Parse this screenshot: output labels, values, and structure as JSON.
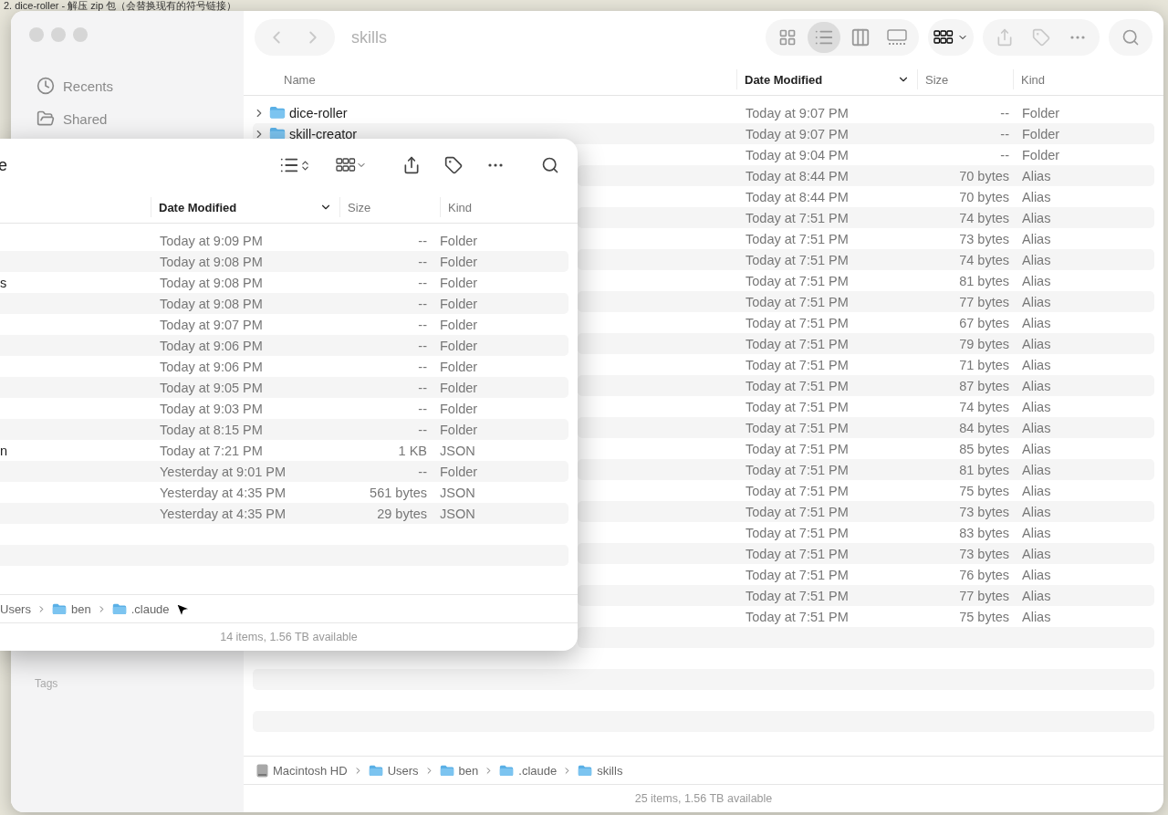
{
  "desktop": {
    "note": "2. dice-roller - 解压 zip 包（会替换现有的符号链接）"
  },
  "back_window": {
    "active": false,
    "title": "skills",
    "sidebar": {
      "items": [
        {
          "label": "Recents"
        },
        {
          "label": "Shared"
        }
      ],
      "tags_heading": "Tags"
    },
    "view_modes": [
      {
        "kind": "icons",
        "selected": false
      },
      {
        "kind": "list",
        "selected": true
      },
      {
        "kind": "columns",
        "selected": false
      },
      {
        "kind": "gallery",
        "selected": false
      }
    ],
    "columns": [
      {
        "label": "Name",
        "sorted": false
      },
      {
        "label": "Date Modified",
        "sorted": true
      },
      {
        "label": "Size",
        "sorted": false
      },
      {
        "label": "Kind",
        "sorted": false
      }
    ],
    "rows": [
      {
        "name": "dice-roller",
        "expanded": false,
        "date": "Today at 9:07 PM",
        "size": "--",
        "file_kind": "Folder"
      },
      {
        "name": "skill-creator",
        "expanded": false,
        "date": "Today at 9:07 PM",
        "size": "--",
        "file_kind": "Folder"
      },
      {
        "date": "Today at 9:04 PM",
        "size": "--",
        "file_kind": "Folder"
      },
      {
        "date": "Today at 8:44 PM",
        "size": "70 bytes",
        "file_kind": "Alias"
      },
      {
        "date": "Today at 8:44 PM",
        "size": "70 bytes",
        "file_kind": "Alias"
      },
      {
        "date": "Today at 7:51 PM",
        "size": "74 bytes",
        "file_kind": "Alias"
      },
      {
        "date": "Today at 7:51 PM",
        "size": "73 bytes",
        "file_kind": "Alias"
      },
      {
        "date": "Today at 7:51 PM",
        "size": "74 bytes",
        "file_kind": "Alias"
      },
      {
        "date": "Today at 7:51 PM",
        "size": "81 bytes",
        "file_kind": "Alias"
      },
      {
        "date": "Today at 7:51 PM",
        "size": "77 bytes",
        "file_kind": "Alias"
      },
      {
        "date": "Today at 7:51 PM",
        "size": "67 bytes",
        "file_kind": "Alias"
      },
      {
        "date": "Today at 7:51 PM",
        "size": "79 bytes",
        "file_kind": "Alias"
      },
      {
        "date": "Today at 7:51 PM",
        "size": "71 bytes",
        "file_kind": "Alias"
      },
      {
        "date": "Today at 7:51 PM",
        "size": "87 bytes",
        "file_kind": "Alias"
      },
      {
        "date": "Today at 7:51 PM",
        "size": "74 bytes",
        "file_kind": "Alias"
      },
      {
        "date": "Today at 7:51 PM",
        "size": "84 bytes",
        "file_kind": "Alias"
      },
      {
        "date": "Today at 7:51 PM",
        "size": "85 bytes",
        "file_kind": "Alias"
      },
      {
        "date": "Today at 7:51 PM",
        "size": "81 bytes",
        "file_kind": "Alias"
      },
      {
        "date": "Today at 7:51 PM",
        "size": "75 bytes",
        "file_kind": "Alias"
      },
      {
        "date": "Today at 7:51 PM",
        "size": "73 bytes",
        "file_kind": "Alias"
      },
      {
        "date": "Today at 7:51 PM",
        "size": "83 bytes",
        "file_kind": "Alias"
      },
      {
        "date": "Today at 7:51 PM",
        "size": "73 bytes",
        "file_kind": "Alias"
      },
      {
        "date": "Today at 7:51 PM",
        "size": "76 bytes",
        "file_kind": "Alias"
      },
      {
        "date": "Today at 7:51 PM",
        "size": "77 bytes",
        "file_kind": "Alias"
      },
      {
        "date": "Today at 7:51 PM",
        "size": "75 bytes",
        "file_kind": "Alias"
      }
    ],
    "path": [
      {
        "label": "Macintosh HD",
        "kind": "disk"
      },
      {
        "label": "Users",
        "kind": "folder"
      },
      {
        "label": "ben",
        "kind": "folder"
      },
      {
        "label": ".claude",
        "kind": "folder"
      },
      {
        "label": "skills",
        "kind": "folder"
      }
    ],
    "status": "25 items, 1.56 TB available"
  },
  "front_window": {
    "title": "e",
    "columns": [
      {
        "label": "Date Modified",
        "sorted": true
      },
      {
        "label": "Size",
        "sorted": false
      },
      {
        "label": "Kind",
        "sorted": false
      }
    ],
    "rows": [
      {
        "date": "Today at 9:09 PM",
        "size": "--",
        "file_kind": "Folder"
      },
      {
        "date": "Today at 9:08 PM",
        "size": "--",
        "file_kind": "Folder"
      },
      {
        "name": "s",
        "date": "Today at 9:08 PM",
        "size": "--",
        "file_kind": "Folder"
      },
      {
        "date": "Today at 9:08 PM",
        "size": "--",
        "file_kind": "Folder"
      },
      {
        "date": "Today at 9:07 PM",
        "size": "--",
        "file_kind": "Folder"
      },
      {
        "date": "Today at 9:06 PM",
        "size": "--",
        "file_kind": "Folder"
      },
      {
        "date": "Today at 9:06 PM",
        "size": "--",
        "file_kind": "Folder"
      },
      {
        "date": "Today at 9:05 PM",
        "size": "--",
        "file_kind": "Folder"
      },
      {
        "date": "Today at 9:03 PM",
        "size": "--",
        "file_kind": "Folder"
      },
      {
        "date": "Today at 8:15 PM",
        "size": "--",
        "file_kind": "Folder"
      },
      {
        "name": "n",
        "date": "Today at 7:21 PM",
        "size": "1 KB",
        "file_kind": "JSON"
      },
      {
        "date": "Yesterday at 9:01 PM",
        "size": "--",
        "file_kind": "Folder"
      },
      {
        "date": "Yesterday at 4:35 PM",
        "size": "561 bytes",
        "file_kind": "JSON"
      },
      {
        "date": "Yesterday at 4:35 PM",
        "size": "29 bytes",
        "file_kind": "JSON"
      }
    ],
    "path": [
      {
        "label": "Users",
        "kind": "plain"
      },
      {
        "label": "ben",
        "kind": "folder"
      },
      {
        "label": ".claude",
        "kind": "folder"
      }
    ],
    "status": "14 items, 1.56 TB available"
  }
}
